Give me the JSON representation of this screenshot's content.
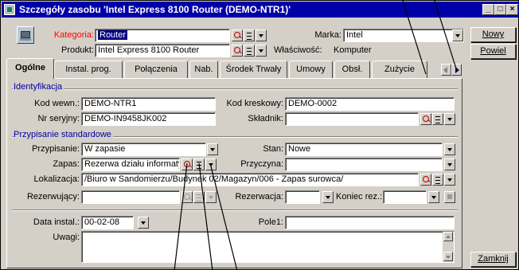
{
  "window": {
    "title": "Szczegóły zasobu 'Intel Express 8100 Router (DEMO-NTR1)'",
    "controls": [
      "_",
      "□",
      "×"
    ]
  },
  "header": {
    "kategoria_label": "Kategoria:",
    "kategoria_value": "Router",
    "produkt_label": "Produkt:",
    "produkt_value": "Intel Express 8100 Router",
    "marka_label": "Marka:",
    "marka_value": "Intel",
    "wlasciwosc_label": "Właściwość:",
    "wlasciwosc_value": "Komputer"
  },
  "side_buttons": {
    "nowy": "Nowy",
    "powiel": "Powiel",
    "zamknij": "Zamknij"
  },
  "tabs": [
    {
      "label": "Ogólne"
    },
    {
      "label": "Instal. prog."
    },
    {
      "label": "Połączenia"
    },
    {
      "label": "Nab."
    },
    {
      "label": "Środek Trwały"
    },
    {
      "label": "Umowy"
    },
    {
      "label": "Obsł."
    },
    {
      "label": "Zużycie"
    }
  ],
  "identyfikacja": {
    "title": "Identyfikacja",
    "kod_wewn_label": "Kod wewn.:",
    "kod_wewn_value": "DEMO-NTR1",
    "kod_kreskowy_label": "Kod kreskowy:",
    "kod_kreskowy_value": "DEMO-0002",
    "nr_seryjny_label": "Nr seryjny:",
    "nr_seryjny_value": "DEMO-IN9458JK002",
    "skladnik_label": "Składnik:",
    "skladnik_value": ""
  },
  "przypisanie": {
    "title": "Przypisanie standardowe",
    "przypisanie_label": "Przypisanie:",
    "przypisanie_value": "W zapasie",
    "stan_label": "Stan:",
    "stan_value": "Nowe",
    "zapas_label": "Zapas:",
    "zapas_value": "Rezerwa działu informaty",
    "przyczyna_label": "Przyczyna:",
    "przyczyna_value": "",
    "lokalizacja_label": "Lokalizacja:",
    "lokalizacja_value": "/Biuro w Sandomierzu/Budynek 02/Magazyn/006 - Zapas surowca/",
    "rezerwujacy_label": "Rezerwujący:",
    "rezerwujacy_value": "",
    "rezerwacja_label": "Rezerwacja:",
    "rezerwacja_value": "",
    "koniec_rez_label": "Koniec rez.:",
    "koniec_rez_value": ""
  },
  "other": {
    "data_instal_label": "Data instal.:",
    "data_instal_value": "00-02-08",
    "pole1_label": "Pole1:",
    "pole1_value": "",
    "uwagi_label": "Uwagi:",
    "uwagi_value": ""
  },
  "colors": {
    "titlebar": "#0000a8",
    "window_face": "#d4d0c8",
    "kategoria_label": "#ff0000",
    "group_title": "#0000a0",
    "selection": "#000080"
  }
}
